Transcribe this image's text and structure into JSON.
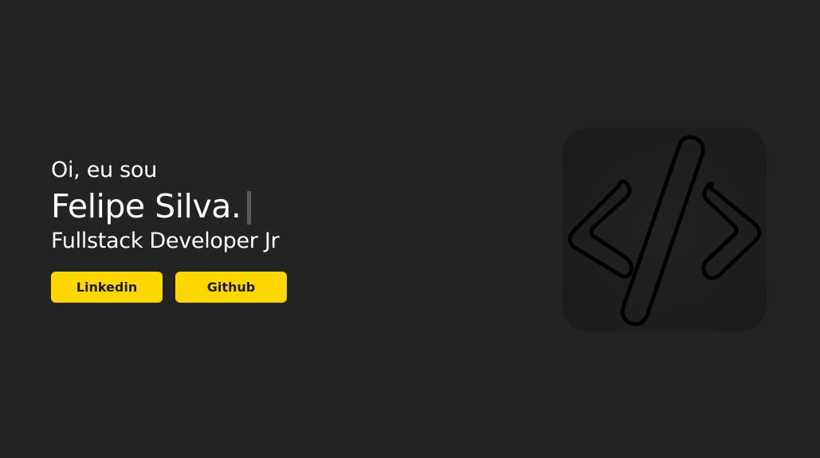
{
  "hero": {
    "greeting": "Oi, eu sou",
    "name": "Felipe Silva.",
    "role": "Fullstack Developer Jr"
  },
  "buttons": {
    "linkedin_label": "Linkedin",
    "github_label": "Github"
  },
  "logo": {
    "icon": "code-icon"
  },
  "colors": {
    "background": "#232323",
    "accent": "#ffd700",
    "text": "#ffffff",
    "tile": "#1f1f1f"
  }
}
